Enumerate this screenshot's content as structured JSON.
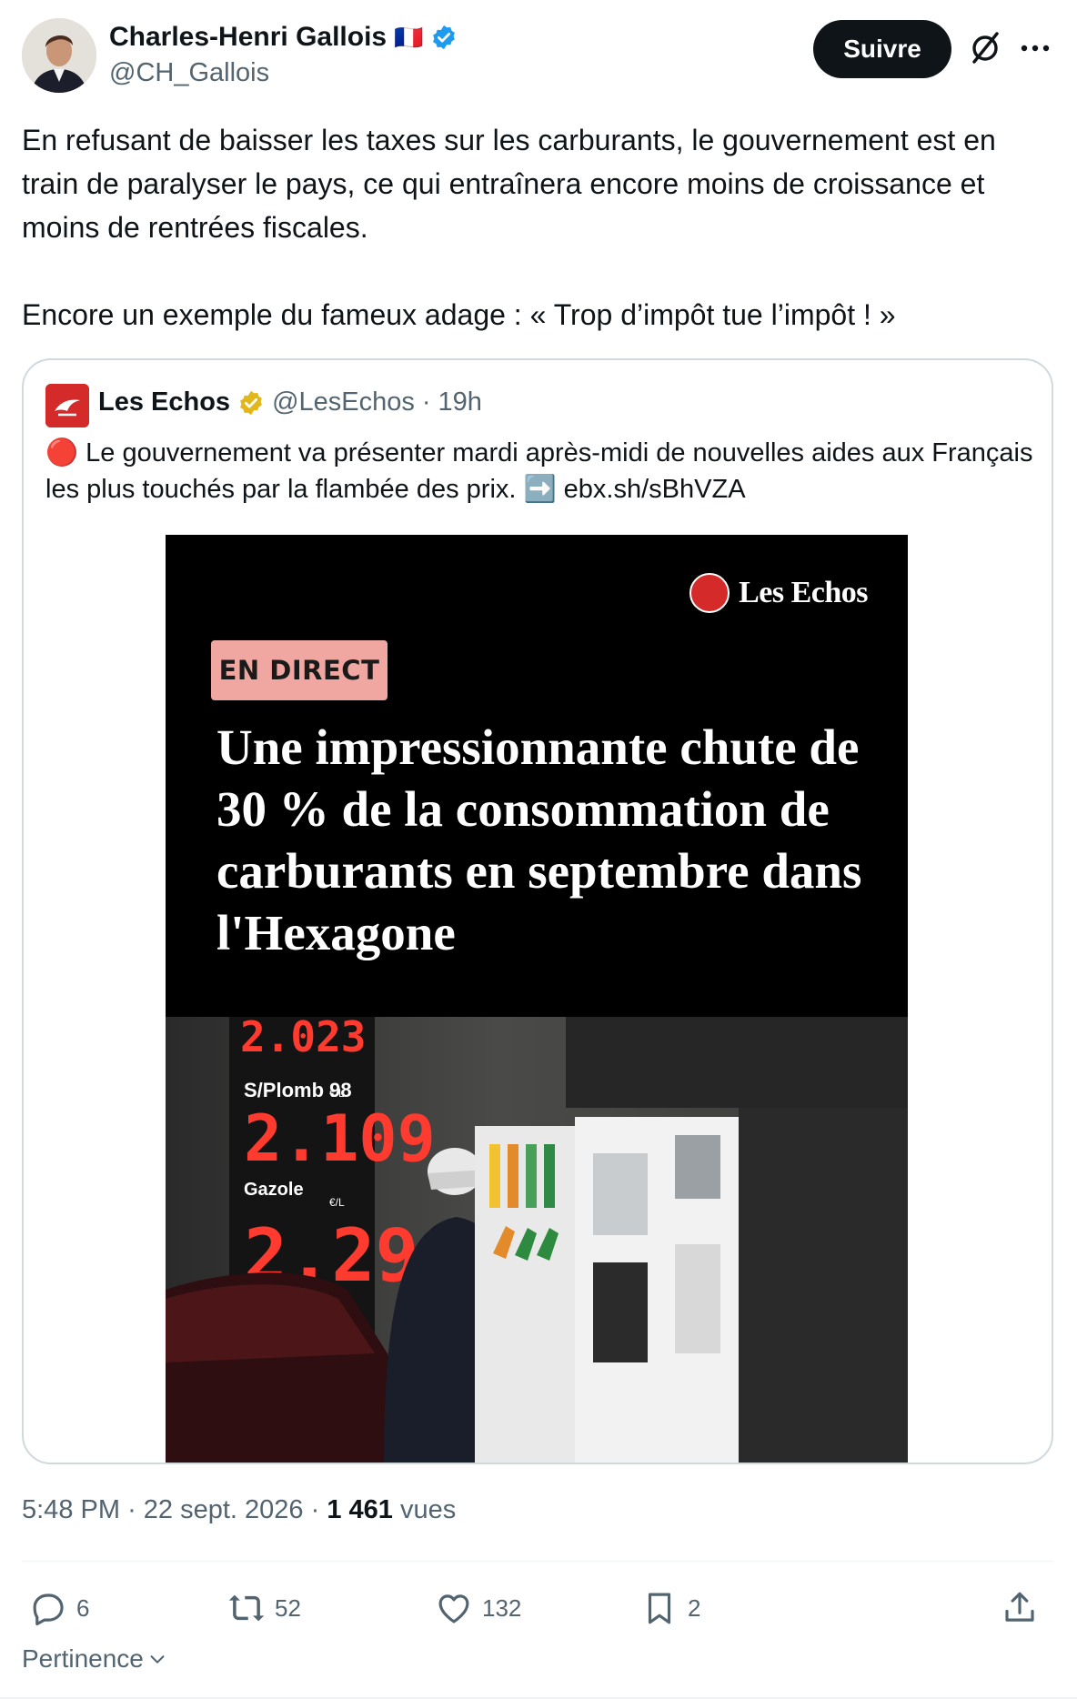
{
  "author": {
    "name": "Charles-Henri Gallois",
    "flag": "🇫🇷",
    "handle": "@CH_Gallois",
    "verified_color": "#1d9bf0"
  },
  "actions_top": {
    "follow_label": "Suivre",
    "grok_icon": "grok-icon",
    "more_icon": "more-icon"
  },
  "tweet": {
    "paragraph_1": "En refusant de baisser les taxes sur les carburants, le gouvernement est en train de paralyser le pays, ce qui entraînera encore moins de croissance et moins de rentrées fiscales.",
    "paragraph_2": "Encore un exemple du fameux adage : « Trop d’impôt tue l’impôt ! »"
  },
  "quote": {
    "name": "Les Echos",
    "handle": "@LesEchos",
    "separator": "·",
    "time": "19h",
    "badge_color": "#e2b719",
    "text_before": "🔴 Le gouvernement va présenter mardi après-midi de nouvelles aides aux Français les plus touchés par la flambée des prix. ➡️ ",
    "link": "ebx.sh/sBhVZA",
    "media": {
      "logo_text": "Les Echos",
      "badge": "EN DIRECT",
      "headline": "Une impressionnante chute de 30 % de la consommation de carburants en septembre dans l'Hexagone",
      "pump_display_1": "2.023",
      "pump_label_1": "S/Plomb 98",
      "pump_unit": "€/L",
      "pump_display_2": "2.109",
      "pump_label_2": "Gazole",
      "pump_display_3": "2.299"
    }
  },
  "meta": {
    "time": "5:48 PM",
    "separator": "·",
    "date": "22 sept. 2026",
    "views_count": "1 461",
    "views_label": "vues"
  },
  "stats": {
    "replies": "6",
    "reposts": "52",
    "likes": "132",
    "bookmarks": "2"
  },
  "sort": {
    "label": "Pertinence"
  },
  "colors": {
    "text_primary": "#0f1419",
    "text_secondary": "#536471",
    "border": "#cfd9de",
    "brand_red": "#d42a2a",
    "badge_pink": "#f0a7a1"
  }
}
